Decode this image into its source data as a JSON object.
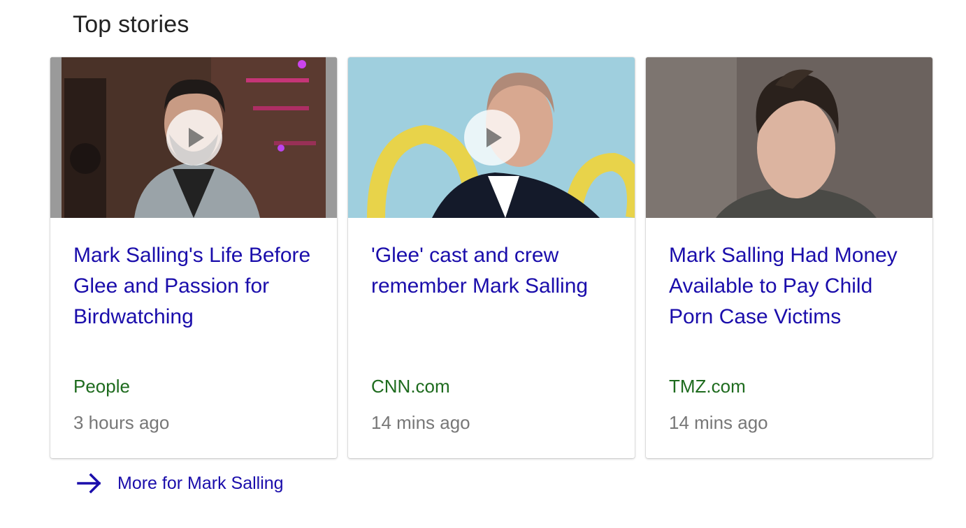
{
  "section": {
    "title": "Top stories"
  },
  "stories": [
    {
      "headline": "Mark Salling's Life Before Glee and Passion for Birdwatching",
      "source": "People",
      "time": "3 hours ago",
      "has_video": true,
      "thumbnail": "man-with-beard-plaid-shirt-photo"
    },
    {
      "headline": "'Glee' cast and crew remember Mark Salling",
      "source": "CNN.com",
      "time": "14 mins ago",
      "has_video": true,
      "thumbnail": "man-shaved-head-blue-background-photo"
    },
    {
      "headline": "Mark Salling Had Money Available to Pay Child Porn Case Victims",
      "source": "TMZ.com",
      "time": "14 mins ago",
      "has_video": false,
      "thumbnail": "man-mohawk-haircut-photo"
    }
  ],
  "more": {
    "label": "More for Mark Salling",
    "icon": "arrow-right-icon"
  },
  "colors": {
    "link": "#1a0dab",
    "source": "#1e6b1e",
    "time": "#777777",
    "title": "#222222"
  }
}
